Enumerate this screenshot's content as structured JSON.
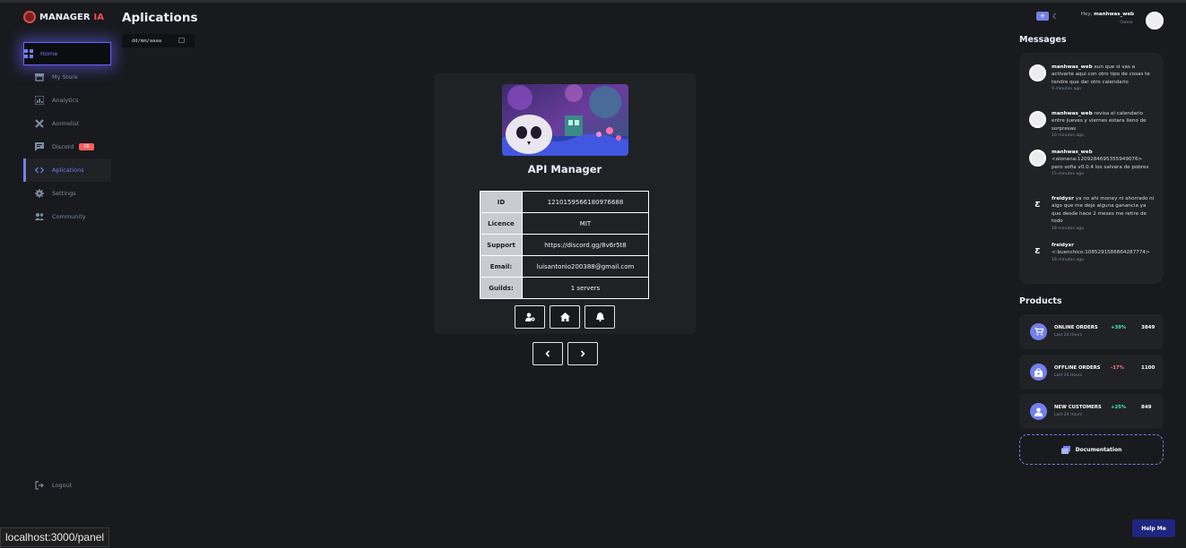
{
  "brand": {
    "name_white": "MANAGER",
    "name_red": "IA"
  },
  "sidebar": {
    "items": [
      {
        "label": "Home",
        "icon": "grid-icon"
      },
      {
        "label": "My Store",
        "icon": "store-icon"
      },
      {
        "label": "Analytics",
        "icon": "analytics-icon"
      },
      {
        "label": "Animelist",
        "icon": "tools-icon"
      },
      {
        "label": "Discord",
        "icon": "message-icon",
        "badge": "26"
      },
      {
        "label": "Aplications",
        "icon": "code-icon"
      },
      {
        "label": "Settings",
        "icon": "gear-icon"
      },
      {
        "label": "Community",
        "icon": "people-icon"
      }
    ],
    "logout": "Logout"
  },
  "main": {
    "title": "Aplications",
    "date_placeholder": "dd/mm/aaaa",
    "card": {
      "title": "API Manager",
      "rows": [
        {
          "key": "ID",
          "value": "1210159566180976688"
        },
        {
          "key": "Licence",
          "value": "MIT"
        },
        {
          "key": "Support",
          "value": "https://discord.gg/8v6r5t8"
        },
        {
          "key": "Email:",
          "value": "luisantonio200388@gmail.com"
        },
        {
          "key": "Guilds:",
          "value": "1 servers"
        }
      ]
    }
  },
  "header": {
    "hey": "Hey,",
    "username": "manhwas_web",
    "role": "Owner"
  },
  "messages": {
    "title": "Messages",
    "items": [
      {
        "user": "manhwas_web",
        "text": "aun que si vas a activarte aqui con otro tipo de cosas te tendre que dar otro calendario",
        "time": "9 minutes ago"
      },
      {
        "user": "manhwas_web",
        "text": "revisa el calendario entre jueves y viernes estara lleno de sorpresas",
        "time": "10 minutes ago"
      },
      {
        "user": "manhwas_web",
        "text": "<alonena:1209284695355949076> pero sofia v0.0.4 los salvara de pobres",
        "time": "15 minutes ago"
      },
      {
        "user": "freidyxr",
        "text": "ya no ahi money ni ahorrado ni algo que me deje alguna ganancia ya que desde hace 2 meses me retire de todo",
        "time": "18 minutes ago"
      },
      {
        "user": "freidyxr",
        "text": "<:buenchico:1085291586864287774>",
        "time": "19 minutes ago"
      }
    ]
  },
  "products": {
    "title": "Products",
    "items": [
      {
        "name": "ONLINE ORDERS",
        "sub": "Last 24 Hours",
        "pct": "+39%",
        "value": "3849",
        "trend": "up"
      },
      {
        "name": "OFFLINE ORDERS",
        "sub": "Last 24 Hours",
        "pct": "-17%",
        "value": "1100",
        "trend": "down"
      },
      {
        "name": "NEW CUSTOMERS",
        "sub": "Last 24 Hours",
        "pct": "+25%",
        "value": "849",
        "trend": "up"
      }
    ],
    "documentation": "Documentation"
  },
  "help": "Help Me",
  "status_url": "localhost:3000/panel"
}
